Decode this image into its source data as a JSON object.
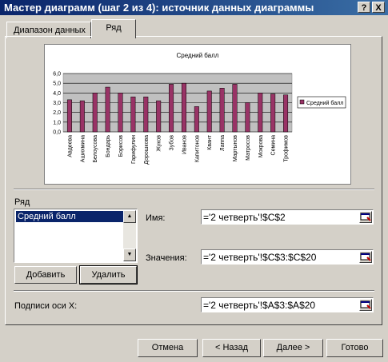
{
  "window": {
    "title": "Мастер диаграмм (шаг 2 из 4): источник данных диаграммы",
    "help_label": "?",
    "close_label": "X"
  },
  "tabs": [
    {
      "label": "Диапазон данных",
      "active": false
    },
    {
      "label": "Ряд",
      "active": true
    }
  ],
  "chart_data": {
    "type": "bar",
    "title": "Средний балл",
    "categories": [
      "Авдеева",
      "Ашихмина",
      "Белоусова",
      "Бондарь",
      "Борисов",
      "Гарифулин",
      "Дорошкова",
      "Жуков",
      "Зубов",
      "Иванов",
      "Капитонов",
      "Квант",
      "Лаппа",
      "Мартынов",
      "Матросов",
      "Мокрова",
      "Семина",
      "Трофимов"
    ],
    "series": [
      {
        "name": "Средний балл",
        "values": [
          3.3,
          3.2,
          4.0,
          4.6,
          4.0,
          3.6,
          3.6,
          3.2,
          4.9,
          5.0,
          2.6,
          4.2,
          4.5,
          4.9,
          3.0,
          4.0,
          3.9,
          3.8
        ]
      }
    ],
    "ylim": [
      0,
      6
    ],
    "yticks": [
      "6,0",
      "5,0",
      "4,0",
      "3,0",
      "2,0",
      "1,0",
      "0,0"
    ],
    "grid": true,
    "legend": "right",
    "bar_color": "#993366",
    "plot_bg": "#c0c0c0"
  },
  "series_section": {
    "label": "Ряд",
    "items": [
      "Средний балл"
    ],
    "selected": 0,
    "add_label": "Добавить",
    "delete_label": "Удалить"
  },
  "fields": {
    "name_label": "Имя:",
    "name_value": "='2 четверть'!$C$2",
    "values_label": "Значения:",
    "values_value": "='2 четверть'!$C$3:$C$20",
    "xlabels_label": "Подписи оси X:",
    "xlabels_value": "='2 четверть'!$A$3:$A$20"
  },
  "buttons": {
    "cancel": "Отмена",
    "back": "< Назад",
    "next": "Далее >",
    "finish": "Готово"
  }
}
